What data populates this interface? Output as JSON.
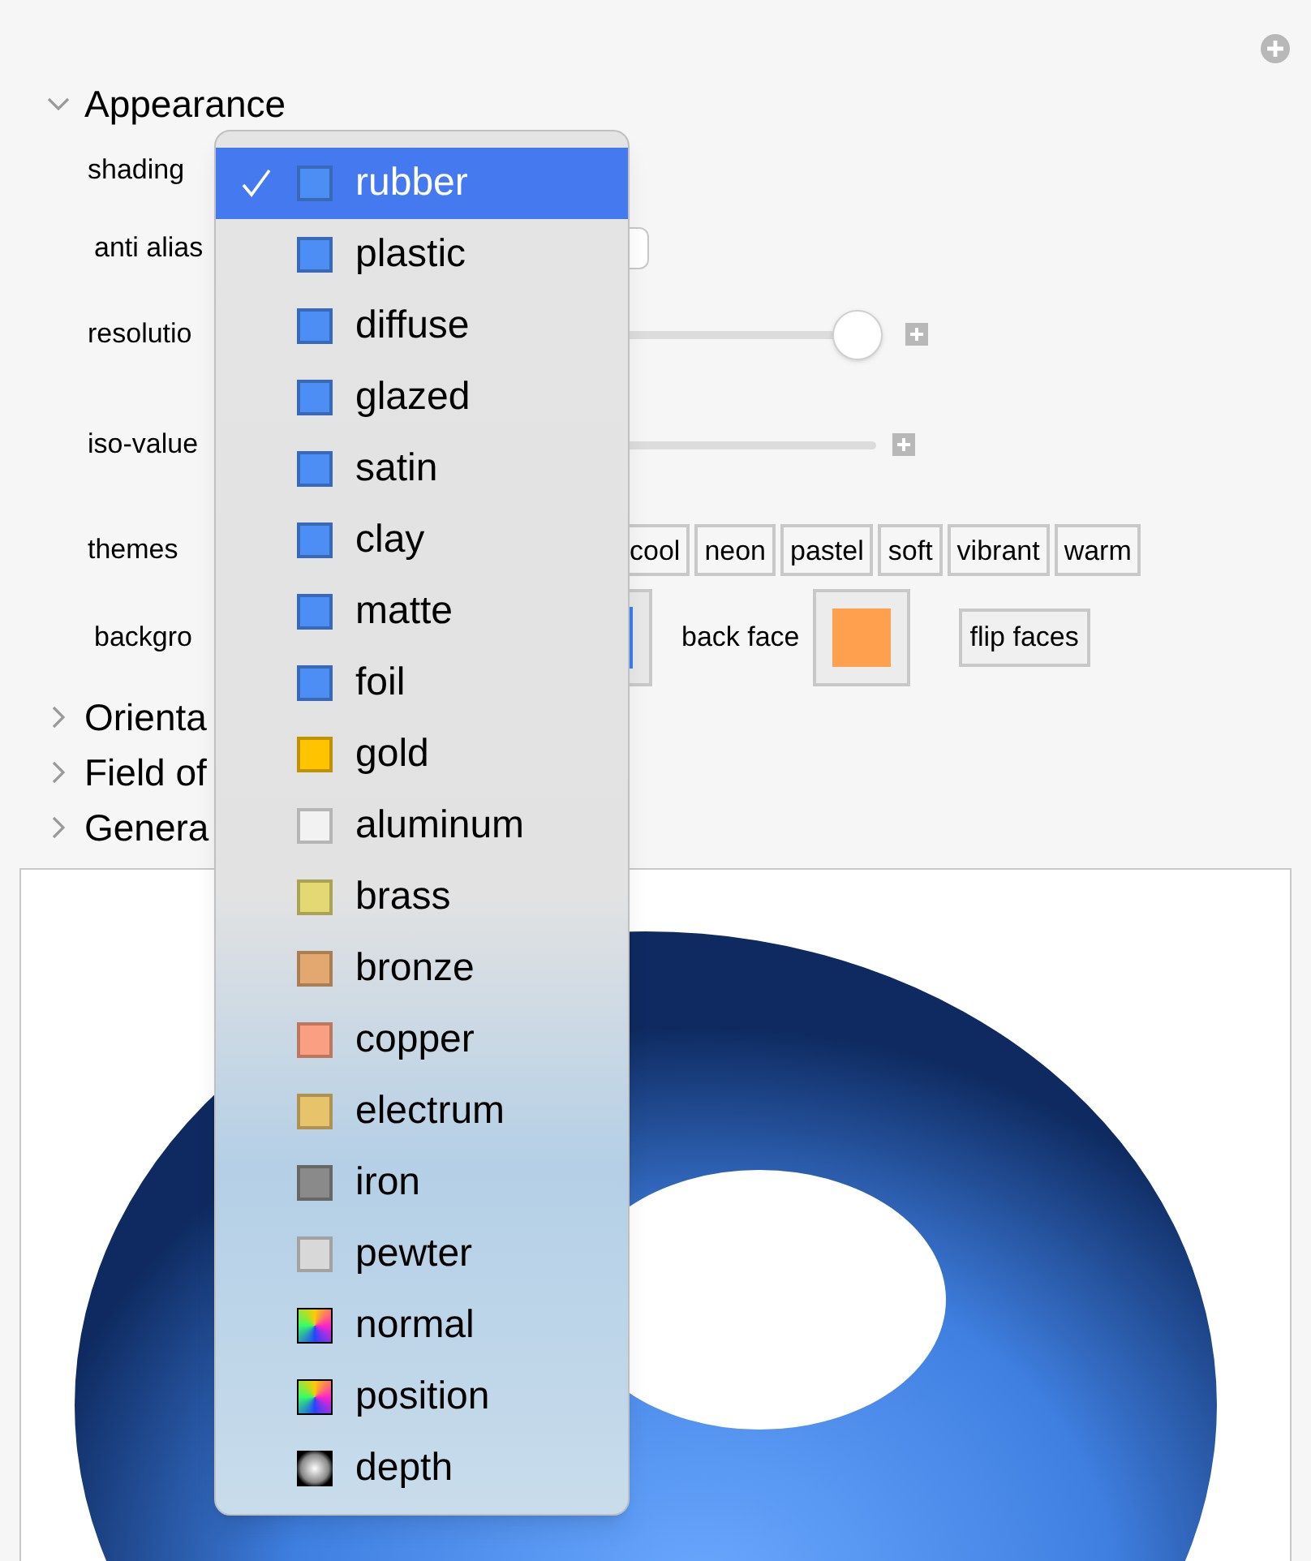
{
  "sections": [
    {
      "label": "Appearance",
      "expanded": true
    },
    {
      "label": "Orienta",
      "expanded": false
    },
    {
      "label": "Field of",
      "expanded": false
    },
    {
      "label": "Genera",
      "expanded": false
    }
  ],
  "controls": {
    "shading": "shading",
    "anti_alias": "anti alias",
    "resolution": {
      "label": "resolutio",
      "level": 0.97
    },
    "iso_value": "iso-value",
    "themes": {
      "label": "themes",
      "buttons": [
        "cool",
        "neon",
        "pastel",
        "soft",
        "vibrant",
        "warm"
      ]
    },
    "background": "backgro",
    "back_face": {
      "label": "back face",
      "color": "#ffa04f"
    },
    "flip_faces": "flip faces"
  },
  "menu": [
    {
      "label": "rubber",
      "kind": "swatch",
      "color": "#4d8ef5",
      "selected": true
    },
    {
      "label": "plastic",
      "kind": "swatch",
      "color": "#4d8ef5",
      "selected": false
    },
    {
      "label": "diffuse",
      "kind": "swatch",
      "color": "#4d8ef5",
      "selected": false
    },
    {
      "label": "glazed",
      "kind": "swatch",
      "color": "#4d8ef5",
      "selected": false
    },
    {
      "label": "satin",
      "kind": "swatch",
      "color": "#4d8ef5",
      "selected": false
    },
    {
      "label": "clay",
      "kind": "swatch",
      "color": "#4d8ef5",
      "selected": false
    },
    {
      "label": "matte",
      "kind": "swatch",
      "color": "#4d8ef5",
      "selected": false
    },
    {
      "label": "foil",
      "kind": "swatch",
      "color": "#4d8ef5",
      "selected": false
    },
    {
      "label": "gold",
      "kind": "swatch",
      "color": "#ffc300",
      "selected": false
    },
    {
      "label": "aluminum",
      "kind": "swatch",
      "color": "#f2f2f2",
      "selected": false
    },
    {
      "label": "brass",
      "kind": "swatch",
      "color": "#e3d873",
      "selected": false
    },
    {
      "label": "bronze",
      "kind": "swatch",
      "color": "#e3a86f",
      "selected": false
    },
    {
      "label": "copper",
      "kind": "swatch",
      "color": "#fb9f82",
      "selected": false
    },
    {
      "label": "electrum",
      "kind": "swatch",
      "color": "#e7c36c",
      "selected": false
    },
    {
      "label": "iron",
      "kind": "swatch",
      "color": "#8a8a8a",
      "selected": false
    },
    {
      "label": "pewter",
      "kind": "swatch",
      "color": "#d8d8d8",
      "selected": false
    },
    {
      "label": "normal",
      "kind": "rainbow",
      "selected": false
    },
    {
      "label": "position",
      "kind": "rainbow",
      "selected": false
    },
    {
      "label": "depth",
      "kind": "depth",
      "selected": false
    }
  ]
}
